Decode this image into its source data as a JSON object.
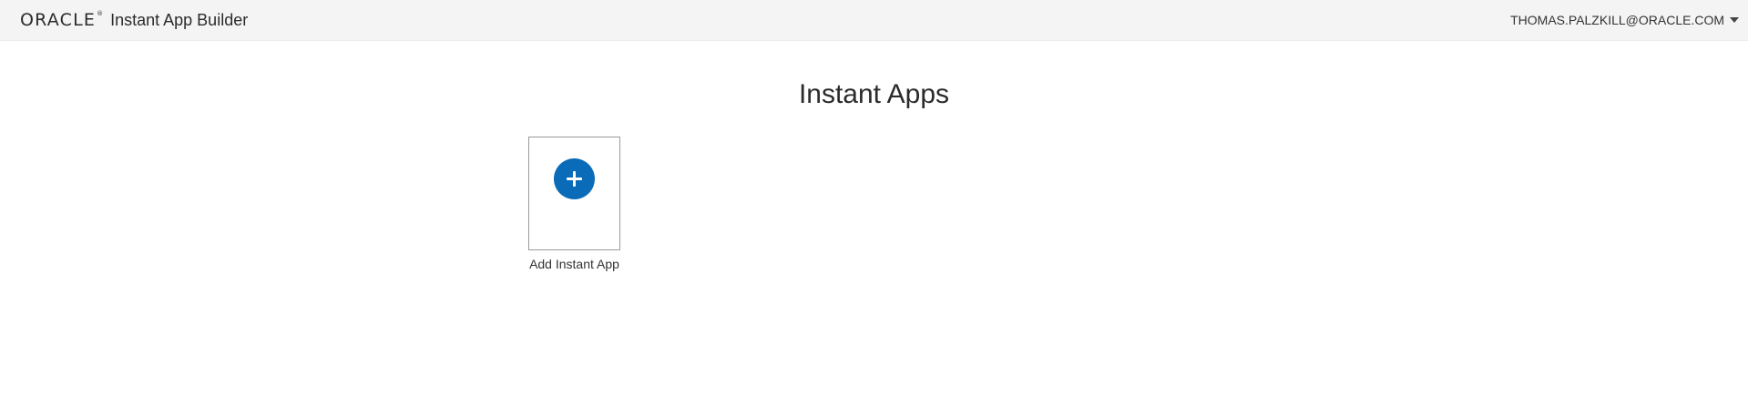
{
  "header": {
    "logo_text": "ORACLE",
    "logo_mark": "®",
    "app_title": "Instant App Builder",
    "user_label": "THOMAS.PALZKILL@ORACLE.COM",
    "user_menu_icon": "caret-down-icon"
  },
  "main": {
    "title": "Instant Apps",
    "tiles": [
      {
        "icon": "plus-circle-icon",
        "label": "Add Instant App",
        "icon_color": "#0a6cb8"
      }
    ]
  },
  "colors": {
    "header_bg": "#f4f4f4",
    "accent": "#0a6cb8",
    "text": "#333333"
  }
}
